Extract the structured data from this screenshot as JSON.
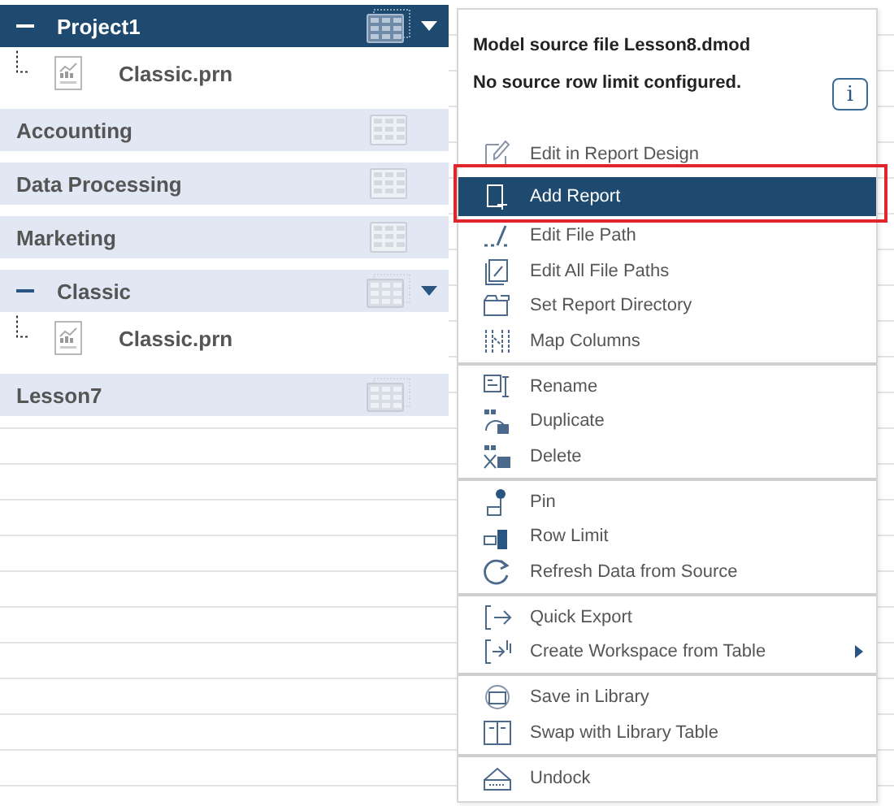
{
  "tree": [
    {
      "label": "Project1",
      "kind": "model",
      "selected": true,
      "expanded": true,
      "children": [
        {
          "label": "Classic.prn"
        }
      ]
    },
    {
      "label": "Accounting",
      "kind": "folder",
      "selected": false
    },
    {
      "label": "Data Processing",
      "kind": "folder",
      "selected": false
    },
    {
      "label": "Marketing",
      "kind": "folder",
      "selected": false
    },
    {
      "label": "Classic",
      "kind": "model",
      "selected": false,
      "expanded": true,
      "children": [
        {
          "label": "Classic.prn"
        }
      ]
    },
    {
      "label": "Lesson7",
      "kind": "model",
      "selected": false,
      "expanded": false
    }
  ],
  "menu": {
    "source": "Model source file Lesson8.dmod",
    "row_limit_note": "No source row limit configured.",
    "info_button": "i",
    "groups": [
      [
        {
          "label": "Edit in Report Design",
          "selected": false,
          "outlined": false
        },
        {
          "label": "Add Report",
          "selected": true,
          "outlined": true
        },
        {
          "label": "Edit File Path",
          "selected": false,
          "outlined": false
        },
        {
          "label": "Edit All File Paths",
          "selected": false,
          "outlined": false
        },
        {
          "label": "Set Report Directory",
          "selected": false,
          "outlined": false
        },
        {
          "label": "Map Columns",
          "selected": false,
          "outlined": false
        }
      ],
      [
        {
          "label": "Rename",
          "selected": false,
          "outlined": false
        },
        {
          "label": "Duplicate",
          "selected": false,
          "outlined": false
        },
        {
          "label": "Delete",
          "selected": false,
          "outlined": false
        }
      ],
      [
        {
          "label": "Pin",
          "selected": false,
          "outlined": false
        },
        {
          "label": "Row Limit",
          "selected": false,
          "outlined": false
        },
        {
          "label": "Refresh Data from Source",
          "selected": false,
          "outlined": false
        }
      ],
      [
        {
          "label": "Quick Export",
          "selected": false,
          "outlined": false
        },
        {
          "label": "Create Workspace from Table",
          "selected": false,
          "outlined": false,
          "has_submenu": true
        }
      ],
      [
        {
          "label": "Save in Library",
          "selected": false,
          "outlined": false
        },
        {
          "label": "Swap with Library Table",
          "selected": false,
          "outlined": false
        }
      ],
      [
        {
          "label": "Undock",
          "selected": false,
          "outlined": false
        }
      ]
    ]
  }
}
